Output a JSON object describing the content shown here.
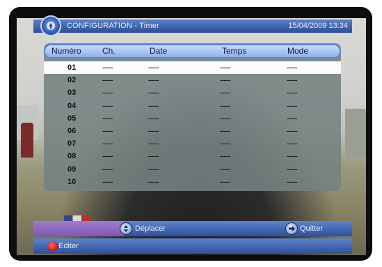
{
  "title": {
    "text": "CONFIGURATION - Timer",
    "datetime": "15/04/2009  13:34",
    "logo_icon": "satellite-logo-icon"
  },
  "table": {
    "headers": [
      "Numéro",
      "Ch.",
      "Date",
      "Temps",
      "Mode"
    ],
    "placeholder": "------",
    "rows": [
      {
        "num": "01",
        "ch": "------",
        "date": "------",
        "time": "------",
        "mode": "------"
      },
      {
        "num": "02",
        "ch": "------",
        "date": "------",
        "time": "------",
        "mode": "------"
      },
      {
        "num": "03",
        "ch": "------",
        "date": "------",
        "time": "------",
        "mode": "------"
      },
      {
        "num": "04",
        "ch": "------",
        "date": "------",
        "time": "------",
        "mode": "------"
      },
      {
        "num": "05",
        "ch": "------",
        "date": "------",
        "time": "------",
        "mode": "------"
      },
      {
        "num": "06",
        "ch": "------",
        "date": "------",
        "time": "------",
        "mode": "------"
      },
      {
        "num": "07",
        "ch": "------",
        "date": "------",
        "time": "------",
        "mode": "------"
      },
      {
        "num": "08",
        "ch": "------",
        "date": "------",
        "time": "------",
        "mode": "------"
      },
      {
        "num": "09",
        "ch": "------",
        "date": "------",
        "time": "------",
        "mode": "------"
      },
      {
        "num": "10",
        "ch": "------",
        "date": "------",
        "time": "------",
        "mode": "------"
      }
    ],
    "selected_index": 0
  },
  "footer": {
    "move_label": "Déplacer",
    "move_icon": "up-down-arrow-icon",
    "exit_label": "Quitter",
    "exit_icon": "exit-arrow-icon",
    "edit_label": "Editer",
    "edit_icon": "red-button-icon"
  },
  "colors": {
    "title_bar": "#3f64ad",
    "header": "#a7c2ee",
    "panel": "#748281",
    "selected_row": "#fbfbfb",
    "nav_accent": "#8256b6",
    "red_button": "#d2201f"
  }
}
